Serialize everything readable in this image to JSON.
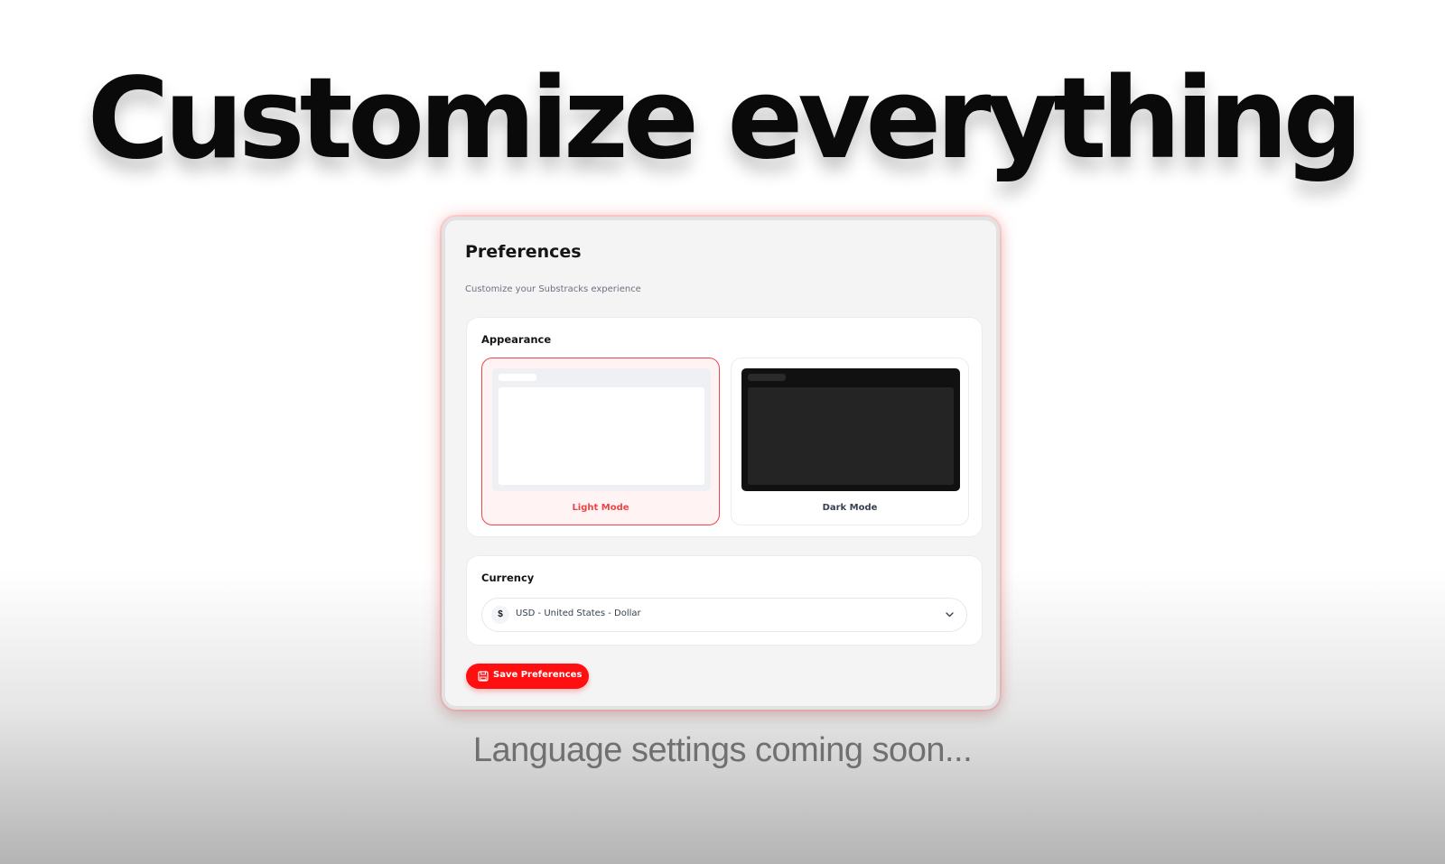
{
  "headline": "Customize everything",
  "preferences": {
    "title": "Preferences",
    "subtitle": "Customize your Substracks experience",
    "appearance": {
      "label": "Appearance",
      "selected": "light",
      "options": [
        {
          "id": "light",
          "label": "Light Mode"
        },
        {
          "id": "dark",
          "label": "Dark Mode"
        }
      ]
    },
    "currency": {
      "label": "Currency",
      "symbol": "$",
      "selected_value": "USD - United States - Dollar"
    },
    "save_label": "Save Preferences"
  },
  "footnote": "Language settings coming soon...",
  "colors": {
    "accent": "#ff0f0f",
    "selected_border": "#ef4444",
    "dark_preview": "#111111"
  },
  "icons": {
    "chevron": "chevron-down-icon",
    "save": "save-icon"
  }
}
